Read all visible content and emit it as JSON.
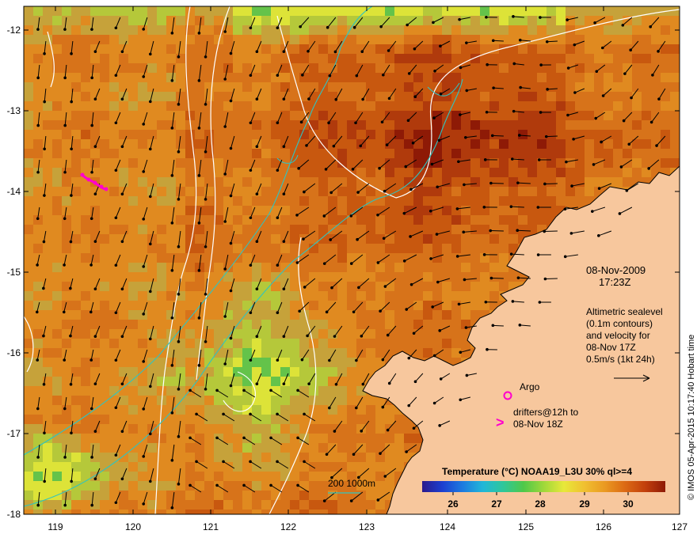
{
  "map": {
    "x_ticks": [
      "119",
      "120",
      "121",
      "122",
      "123",
      "124",
      "125",
      "126",
      "127"
    ],
    "y_ticks": [
      "-12",
      "-13",
      "-14",
      "-15",
      "-16",
      "-17",
      "-18"
    ],
    "land_color": "#f7c79d",
    "sst_colors": [
      "#8e1a06",
      "#b03a0c",
      "#c8580f",
      "#d7731a",
      "#e08a20",
      "#c6a23a",
      "#b5c83a",
      "#dde338",
      "#64c34a",
      "#2bb389",
      "#27a9c8"
    ],
    "contour_colors": {
      "sealevel": "#ffffff",
      "isobath": "#2fc4c0",
      "drifter": "#ff00cc",
      "velocity": "#000000"
    }
  },
  "annotations": {
    "date": "08-Nov-2009",
    "time": "17:23Z",
    "altimetry_lines": [
      "Altimetric sealevel",
      "(0.1m contours)",
      "and velocity for",
      "08-Nov 17Z",
      "0.5m/s (1kt 24h)"
    ],
    "argo_label": "Argo",
    "drifters_lines": [
      "drifters@12h to",
      "08-Nov 18Z"
    ],
    "drifter_symbol": ">",
    "isobath_label": "200  1000m"
  },
  "colorbar": {
    "title": "Temperature (°C) NOAA19_L3U 30% ql>=4",
    "ticks": [
      "26",
      "27",
      "28",
      "29",
      "30"
    ],
    "colors": [
      "#2a1a8c",
      "#1c3fd0",
      "#1d7be0",
      "#21b7d8",
      "#2fc79a",
      "#4fc84a",
      "#9fd83a",
      "#e8e83a",
      "#f0c030",
      "#ea9a22",
      "#dc6a14",
      "#c2400c",
      "#8e1a06"
    ]
  },
  "credit": "© IMOS 05-Apr-2015 10:17:40 Hobart time"
}
